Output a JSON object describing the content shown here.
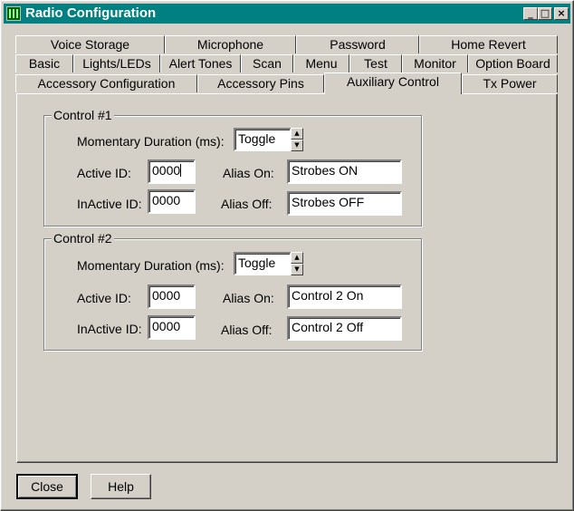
{
  "window": {
    "title": "Radio Configuration",
    "minimize_glyph": "_",
    "maximize_glyph": "□",
    "close_glyph": "×"
  },
  "tabs": {
    "row1": [
      "Voice Storage",
      "Microphone",
      "Password",
      "Home Revert"
    ],
    "row2": [
      "Basic",
      "Lights/LEDs",
      "Alert Tones",
      "Scan",
      "Menu",
      "Test",
      "Monitor",
      "Option Board"
    ],
    "row3": [
      "Accessory Configuration",
      "Accessory Pins",
      "Auxiliary Control",
      "Tx Power"
    ],
    "active": "Auxiliary Control"
  },
  "labels": {
    "momentary": "Momentary Duration (ms):",
    "active_id": "Active ID:",
    "inactive_id": "InActive ID:",
    "alias_on": "Alias On:",
    "alias_off": "Alias Off:"
  },
  "controls": [
    {
      "title": "Control #1",
      "momentary": "Toggle",
      "active_id": "0000",
      "inactive_id": "0000",
      "alias_on": "Strobes ON",
      "alias_off": "Strobes OFF"
    },
    {
      "title": "Control #2",
      "momentary": "Toggle",
      "active_id": "0000",
      "inactive_id": "0000",
      "alias_on": "Control 2 On",
      "alias_off": "Control 2 Off"
    }
  ],
  "buttons": {
    "close": "Close",
    "help": "Help"
  },
  "icons": {
    "app": "radio-config-icon",
    "spin_up": "▲",
    "spin_down": "▼"
  },
  "colors": {
    "titlebar": "#008080",
    "face": "#d4d0c8"
  }
}
